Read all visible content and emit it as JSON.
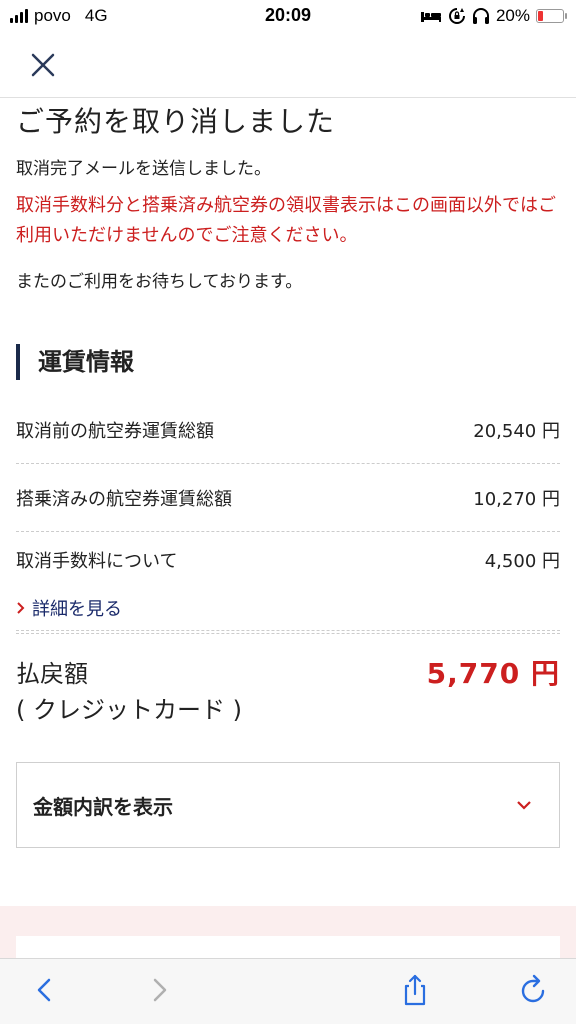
{
  "status_bar": {
    "carrier": "povo",
    "network": "4G",
    "time": "20:09",
    "battery": "20%",
    "battery_color": "#e33333"
  },
  "header": {
    "close_icon": "close-icon"
  },
  "content": {
    "title": "ご予約を取り消しました",
    "message_sent": "取消完了メールを送信しました。",
    "warning": "取消手数料分と搭乗済み航空券の領収書表示はこの画面以外ではご利用いただけませんのでご注意ください。",
    "message_thanks": "またのご利用をお待ちしております。"
  },
  "fare_info": {
    "section_title": "運賃情報",
    "rows": [
      {
        "label": "取消前の航空券運賃総額",
        "value": "20,540 円"
      },
      {
        "label": "搭乗済みの航空券運賃総額",
        "value": "10,270 円"
      },
      {
        "label": "取消手数料について",
        "value": "4,500 円"
      }
    ],
    "details_link": "詳細を見る",
    "refund_label_1": "払戻額",
    "refund_label_2": "( クレジットカード )",
    "refund_amount": "5,770 円",
    "breakdown_label": "金額内訳を表示"
  },
  "colors": {
    "accent_red": "#cc1f1f",
    "navy": "#1a2a4a",
    "link": "#1a2a6a"
  },
  "toolbar": {
    "back_icon": "chevron-left-icon",
    "forward_icon": "chevron-right-icon",
    "share_icon": "share-icon",
    "reload_icon": "reload-icon"
  }
}
